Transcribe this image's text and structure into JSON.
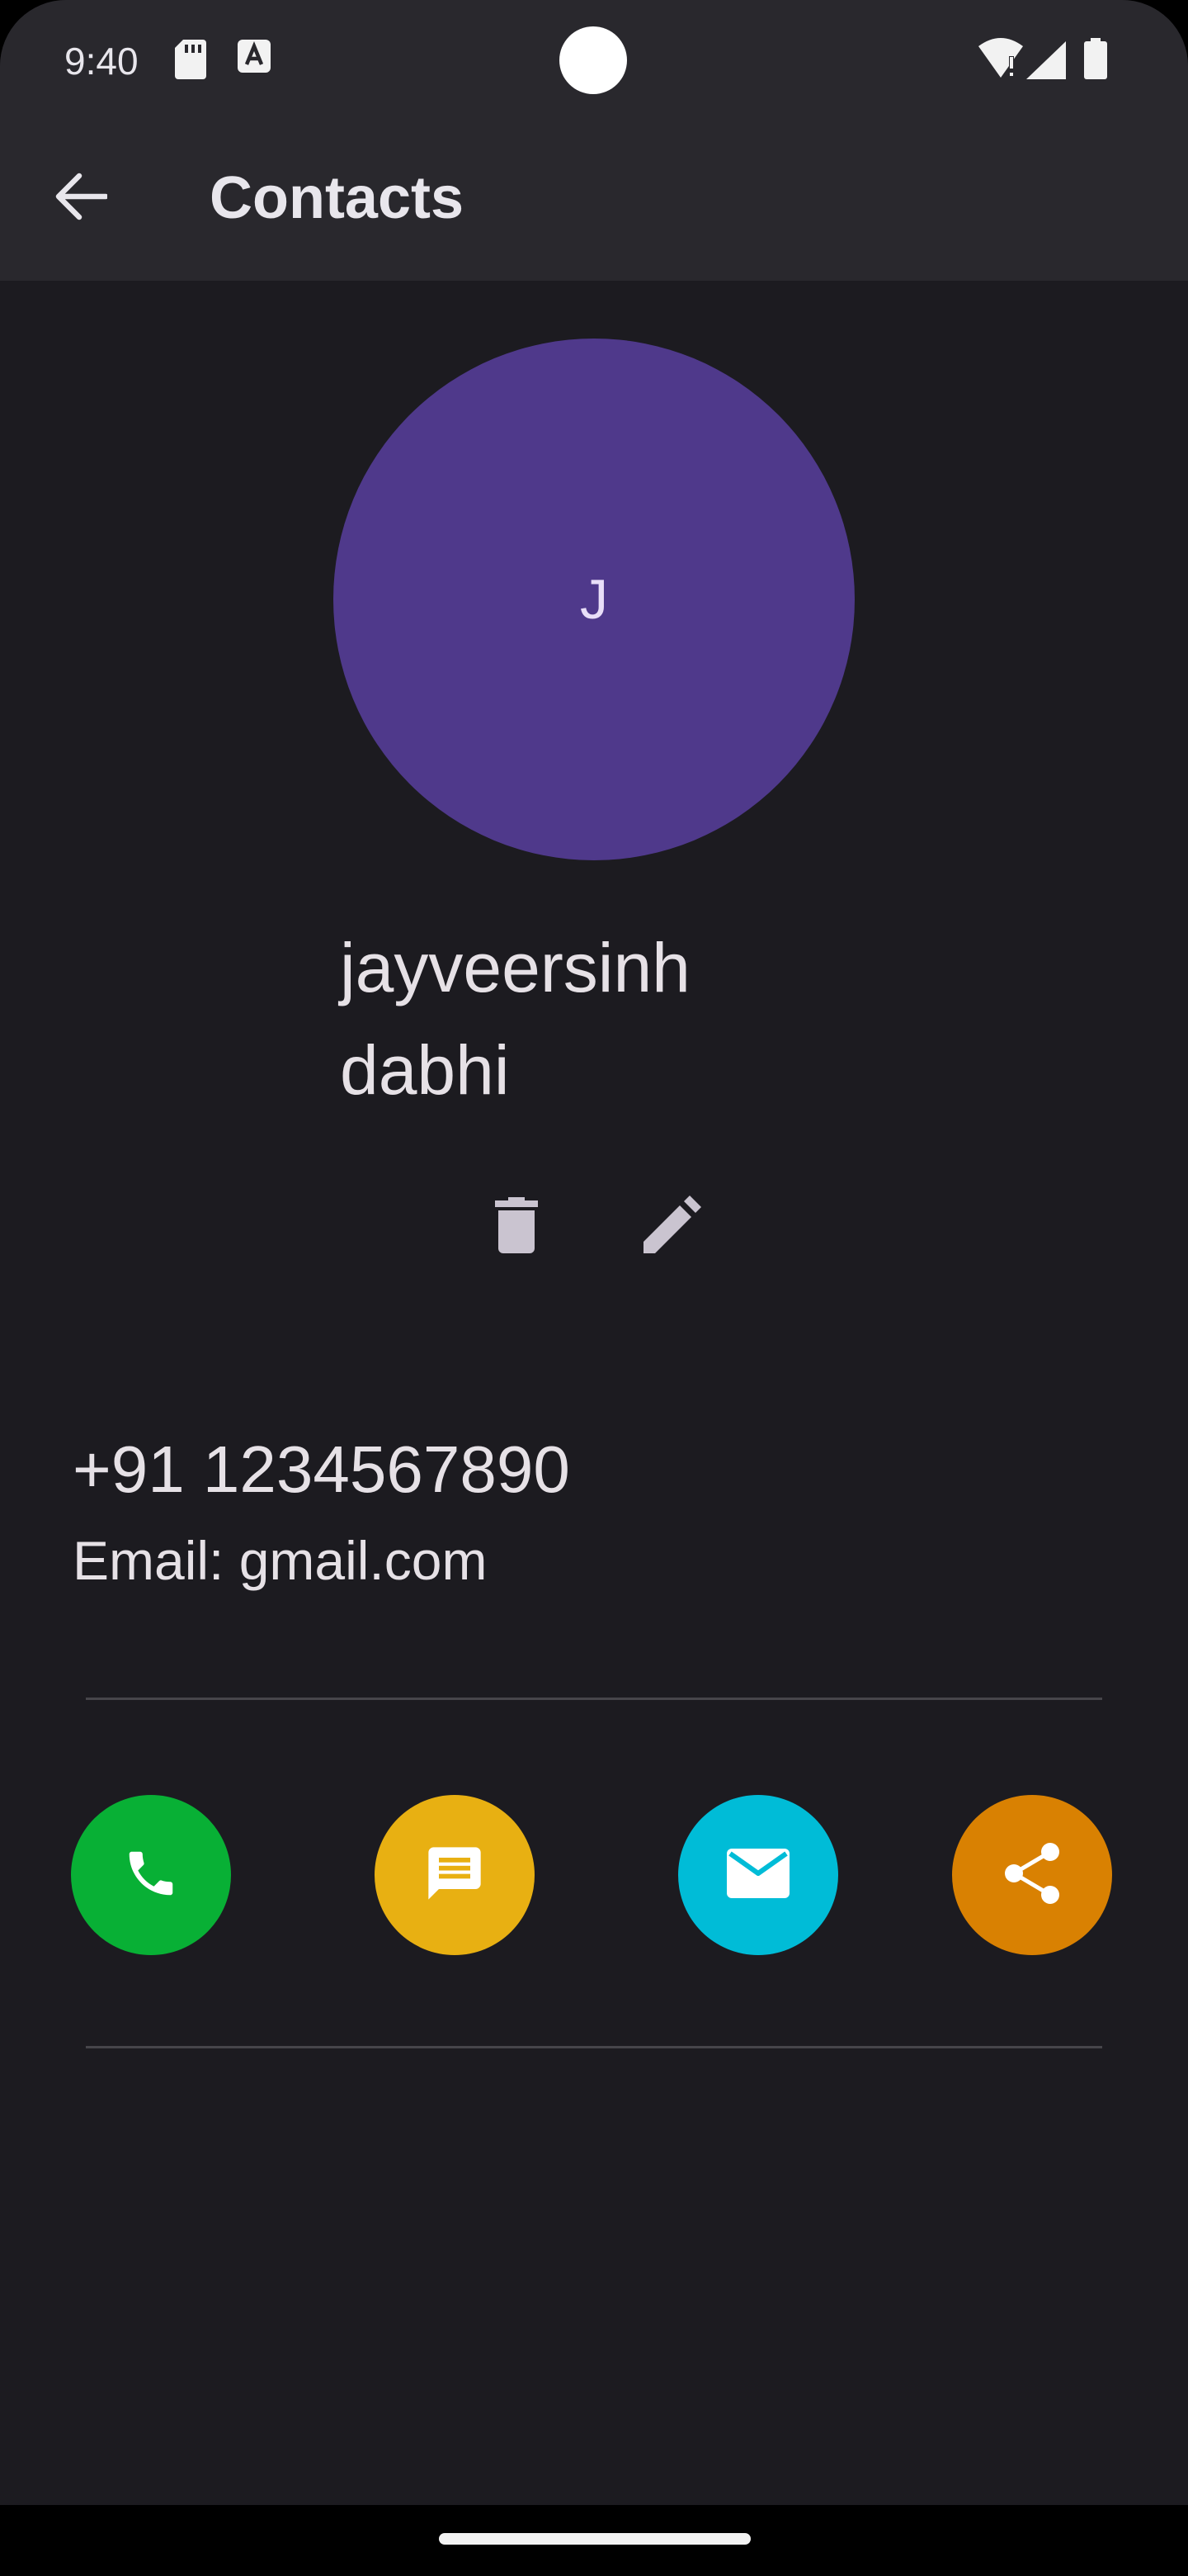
{
  "status_bar": {
    "time": "9:40",
    "left_icons": [
      "sd-card-icon",
      "text-recognition-icon"
    ],
    "right_icons": [
      "wifi-alert-icon",
      "cell-signal-icon",
      "battery-icon"
    ]
  },
  "app_bar": {
    "back_icon": "arrow-back-icon",
    "title": "Contacts"
  },
  "contact": {
    "avatar_letter": "J",
    "avatar_color": "#4f398b",
    "name": "jayveersinh dabhi",
    "phone": "+91 1234567890",
    "email": "Email: gmail.com"
  },
  "contact_actions": {
    "delete_icon": "trash-icon",
    "edit_icon": "pencil-icon"
  },
  "quick_actions": [
    {
      "name": "call",
      "icon": "phone-icon",
      "color": "#08b035"
    },
    {
      "name": "message",
      "icon": "chat-icon",
      "color": "#e8b012"
    },
    {
      "name": "email",
      "icon": "mail-icon",
      "color": "#00bcd7"
    },
    {
      "name": "share",
      "icon": "share-icon",
      "color": "#d98102"
    }
  ],
  "theme": {
    "background": "#1c1b20",
    "top_bar": "#29282d",
    "text": "#e6e1e6",
    "divider": "#46454a"
  }
}
